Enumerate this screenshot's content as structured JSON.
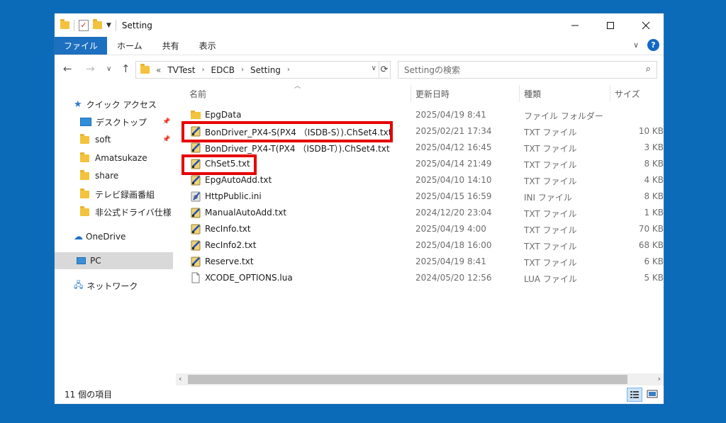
{
  "window": {
    "title": "Setting"
  },
  "ribbon": {
    "tabs": [
      "ファイル",
      "ホーム",
      "共有",
      "表示"
    ]
  },
  "address": {
    "overflow": "«",
    "crumbs": [
      "TVTest",
      "EDCB",
      "Setting"
    ]
  },
  "search": {
    "placeholder": "Settingの検索"
  },
  "sidebar": {
    "quick_access": "クイック アクセス",
    "items": [
      "デスクトップ",
      "soft",
      "Amatsukaze",
      "share",
      "テレビ録画番組",
      "非公式ドライバ仕様"
    ],
    "onedrive": "OneDrive",
    "pc": "PC",
    "network": "ネットワーク"
  },
  "columns": {
    "name": "名前",
    "date": "更新日時",
    "type": "種類",
    "size": "サイズ"
  },
  "files": [
    {
      "name": "EpgData",
      "date": "2025/04/19 8:41",
      "type": "ファイル フォルダー",
      "size": "",
      "icon": "folder-icon"
    },
    {
      "name": "BonDriver_PX4-S(PX4 （ISDB-S）).ChSet4.txt",
      "date": "2025/02/21 17:34",
      "type": "TXT ファイル",
      "size": "10 KB",
      "icon": "text-editor-icon"
    },
    {
      "name": "BonDriver_PX4-T(PX4 （ISDB-T）).ChSet4.txt",
      "date": "2025/04/12 16:45",
      "type": "TXT ファイル",
      "size": "3 KB",
      "icon": "text-editor-icon"
    },
    {
      "name": "ChSet5.txt",
      "date": "2025/04/14 21:49",
      "type": "TXT ファイル",
      "size": "8 KB",
      "icon": "text-editor-icon"
    },
    {
      "name": "EpgAutoAdd.txt",
      "date": "2025/04/10 14:10",
      "type": "TXT ファイル",
      "size": "4 KB",
      "icon": "text-editor-icon"
    },
    {
      "name": "HttpPublic.ini",
      "date": "2025/04/15 16:59",
      "type": "INI ファイル",
      "size": "8 KB",
      "icon": "settings-file-icon"
    },
    {
      "name": "ManualAutoAdd.txt",
      "date": "2024/12/20 23:04",
      "type": "TXT ファイル",
      "size": "1 KB",
      "icon": "text-editor-icon"
    },
    {
      "name": "RecInfo.txt",
      "date": "2025/04/19 4:00",
      "type": "TXT ファイル",
      "size": "70 KB",
      "icon": "text-editor-icon"
    },
    {
      "name": "RecInfo2.txt",
      "date": "2025/04/18 16:00",
      "type": "TXT ファイル",
      "size": "68 KB",
      "icon": "text-editor-icon"
    },
    {
      "name": "Reserve.txt",
      "date": "2025/04/19 8:41",
      "type": "TXT ファイル",
      "size": "6 KB",
      "icon": "text-editor-icon"
    },
    {
      "name": "XCODE_OPTIONS.lua",
      "date": "2024/05/20 12:56",
      "type": "LUA ファイル",
      "size": "5 KB",
      "icon": "blank-file-icon"
    }
  ],
  "status": {
    "count": "11 個の項目"
  },
  "colors": {
    "highlight": "#e60000",
    "accent": "#1d6fbf",
    "background": "#0b6bb8"
  }
}
